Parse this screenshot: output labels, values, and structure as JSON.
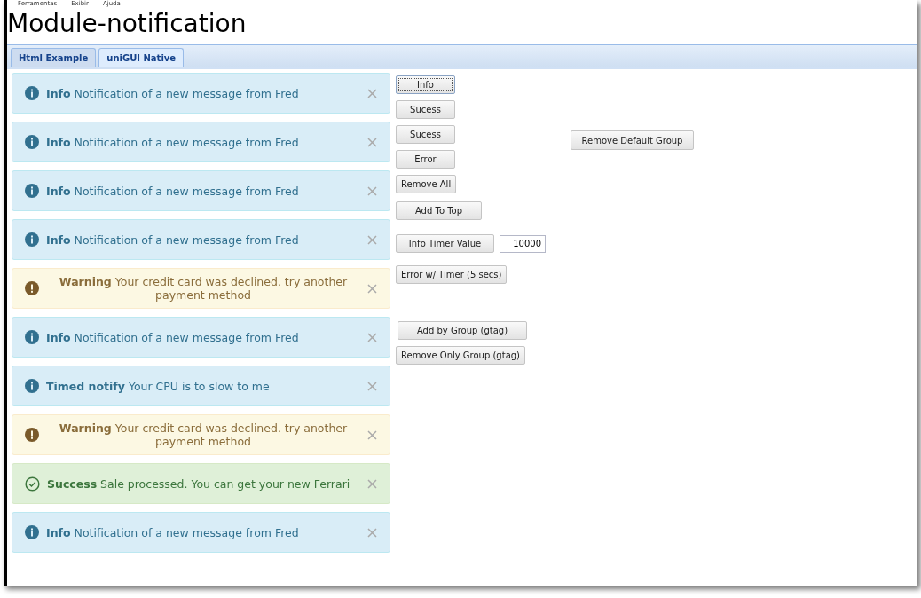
{
  "menu": [
    "Ferramentas",
    "Exibir",
    "Ajuda"
  ],
  "title": "Module-notification",
  "tabs": [
    {
      "label": "Html Example",
      "selected": false
    },
    {
      "label": "uniGUI Native",
      "selected": true
    }
  ],
  "notifications": [
    {
      "kind": "info",
      "title": "Info",
      "message": "Notification of a new message from Fred"
    },
    {
      "kind": "info",
      "title": "Info",
      "message": "Notification of a new message from Fred"
    },
    {
      "kind": "info",
      "title": "Info",
      "message": "Notification of a new message from Fred"
    },
    {
      "kind": "info",
      "title": "Info",
      "message": "Notification of a new message from Fred"
    },
    {
      "kind": "warning",
      "title": "Warning",
      "message": "Your credit card was declined. try another payment method"
    },
    {
      "kind": "info",
      "title": "Info",
      "message": "Notification of a new message from Fred"
    },
    {
      "kind": "info",
      "title": "Timed notify",
      "message": "Your CPU is to slow to me"
    },
    {
      "kind": "warning",
      "title": "Warning",
      "message": "Your credit card was declined. try another payment method"
    },
    {
      "kind": "success",
      "title": "Success",
      "message": "Sale processed. You can get your new Ferrari"
    },
    {
      "kind": "info",
      "title": "Info",
      "message": "Notification of a new message from Fred"
    }
  ],
  "controls": [
    {
      "label": "Info",
      "focused": true
    },
    {
      "label": "Sucess",
      "focused": false
    },
    {
      "label": "Sucess",
      "focused": false
    },
    {
      "label": "Error",
      "focused": false
    },
    {
      "label": "Remove All",
      "focused": false
    },
    {
      "label": "Add To Top",
      "focused": false
    },
    {
      "label": "Info Timer Value",
      "focused": false
    },
    {
      "label": "Error w/ Timer (5 secs)",
      "focused": false
    },
    {
      "label": "Add by Group (gtag)",
      "focused": false
    },
    {
      "label": "Remove Only Group (gtag)",
      "focused": false
    }
  ],
  "side_button": {
    "label": "Remove Default Group"
  },
  "timer_field": {
    "value": "10000"
  }
}
